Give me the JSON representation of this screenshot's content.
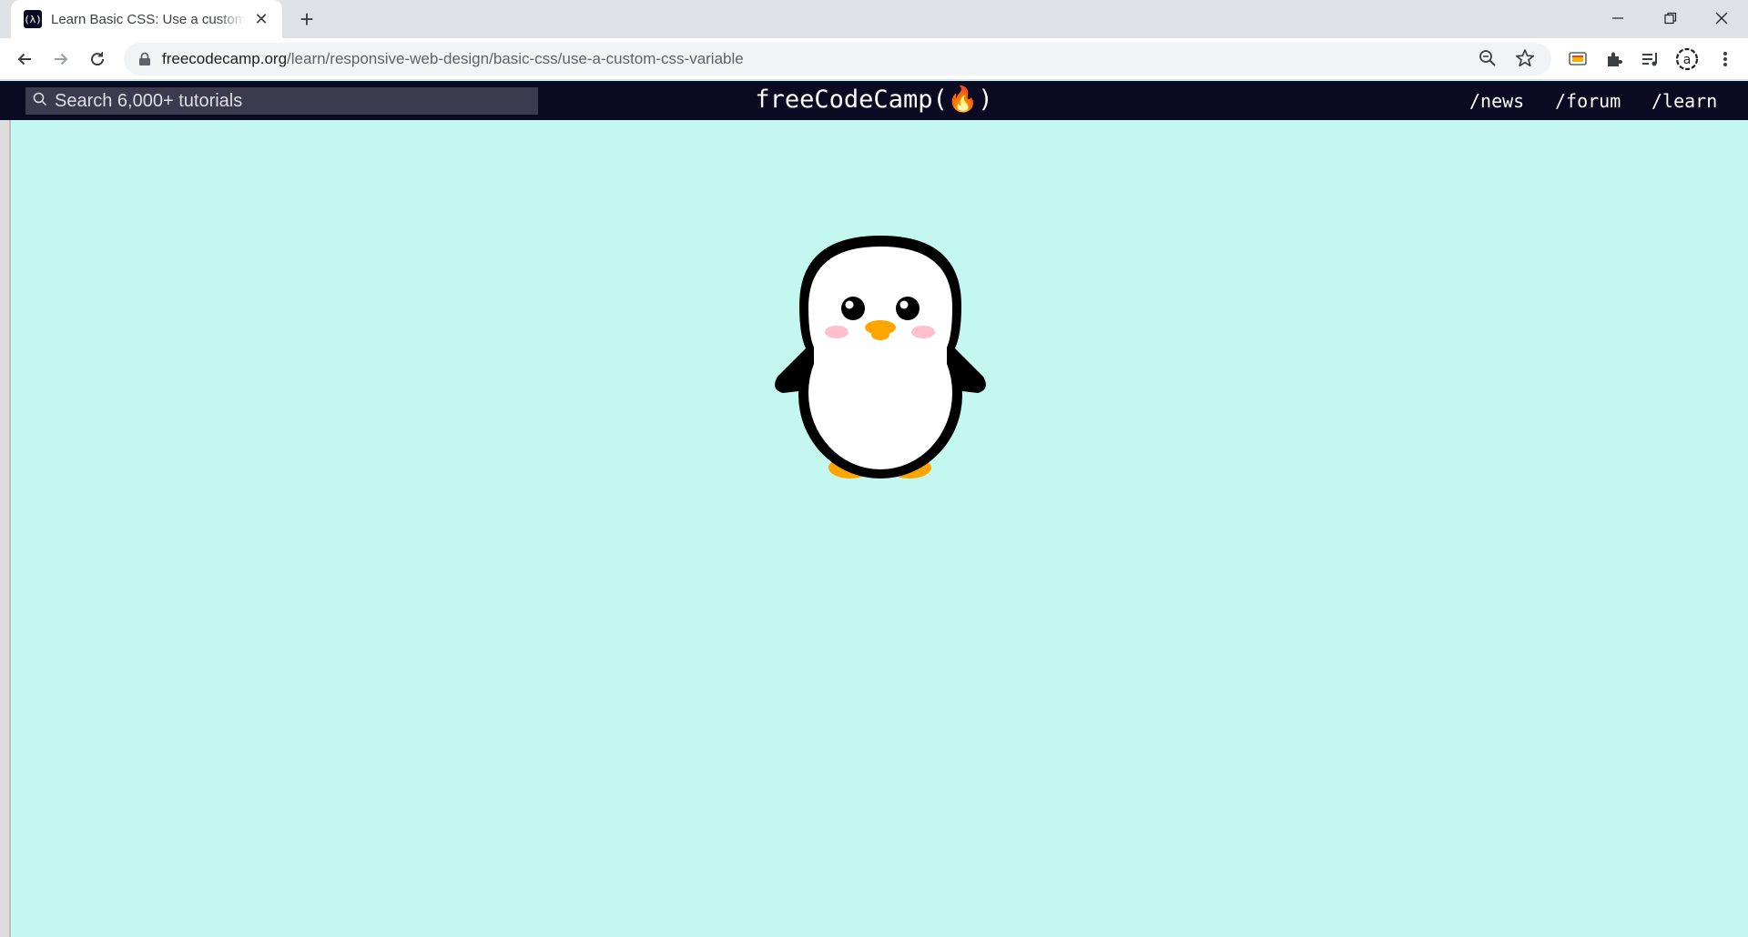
{
  "browser": {
    "tab_title": "Learn Basic CSS: Use a custom CSS Variable | freeCodeCamp.org",
    "favicon_text": "(λ)",
    "url_host": "freecodecamp.org",
    "url_path": "/learn/responsive-web-design/basic-css/use-a-custom-css-variable",
    "icons": [
      "back-icon",
      "forward-icon",
      "reload-icon",
      "lock-icon",
      "zoom-icon",
      "star-icon",
      "cast-icon",
      "extensions-icon",
      "media-icon",
      "profile-icon",
      "menu-icon"
    ]
  },
  "fcc": {
    "search_placeholder": "Search 6,000+ tutorials",
    "logo": "freeCodeCamp(🔥)",
    "links": [
      "/news",
      "/forum",
      "/learn"
    ]
  },
  "page": {
    "background": "#c4f7ef",
    "penguin": {
      "body_color": "#000000",
      "belly_color": "#ffffff",
      "beak_color": "#ffa500",
      "cheek_color": "#ffc0cb",
      "feet_color": "#ffa500"
    }
  }
}
